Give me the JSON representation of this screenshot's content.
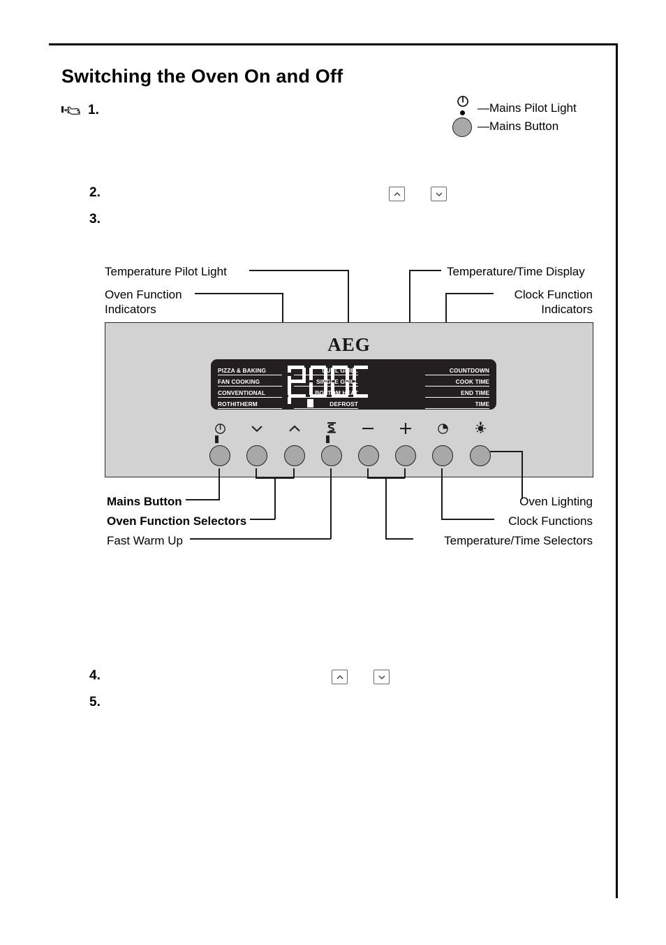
{
  "document": {
    "heading": "Switching the Oven On and Off",
    "steps": [
      {
        "n": "1."
      },
      {
        "n": "2."
      },
      {
        "n": "3."
      },
      {
        "n": "4."
      },
      {
        "n": "5."
      }
    ]
  },
  "legend": {
    "pilot_light_label": "Mains Pilot Light",
    "mains_button_label": "Mains Button"
  },
  "callouts": {
    "temperature_pilot_light": "Temperature Pilot Light",
    "oven_function_indicators_line1": "Oven Function",
    "oven_function_indicators_line2": "Indicators",
    "temperature_time_display": "Temperature/Time Display",
    "clock_function_indicators_line1": "Clock Function",
    "clock_function_indicators_line2": "Indicators",
    "mains_button": "Mains Button",
    "oven_function_selectors": "Oven Function Selectors",
    "fast_warm_up": "Fast Warm Up",
    "oven_lighting": "Oven Lighting",
    "clock_functions": "Clock Functions",
    "temperature_time_selectors": "Temperature/Time Selectors"
  },
  "panel": {
    "brand": "AEG",
    "display_value": "200C",
    "oven_functions_left": [
      "PIZZA & BAKING",
      "FAN COOKING",
      "CONVENTIONAL",
      "ROTHITHERM"
    ],
    "oven_functions_right": [
      "DUAL GRILL",
      "SINGLE GRILL",
      "BOTTOM HEAT",
      "DEFROST"
    ],
    "clock_functions": [
      "COUNTDOWN",
      "COOK TIME",
      "END TIME",
      "TIME"
    ],
    "buttons": [
      {
        "name": "mains",
        "icon": "power-icon"
      },
      {
        "name": "function-down",
        "icon": "chevron-down-icon"
      },
      {
        "name": "function-up",
        "icon": "chevron-up-icon"
      },
      {
        "name": "fast-warm-up",
        "icon": "fast-warm-up-icon"
      },
      {
        "name": "minus",
        "icon": "minus-icon"
      },
      {
        "name": "plus",
        "icon": "plus-icon"
      },
      {
        "name": "clock",
        "icon": "clock-icon"
      },
      {
        "name": "oven-light",
        "icon": "lamp-icon"
      }
    ],
    "colors": {
      "panel_face": "#d2d2d2",
      "display_background": "#231f20",
      "button_face": "#a8a8a8",
      "outline": "#1f1f1f"
    }
  },
  "keycaps": {
    "up": "chevron-up-icon",
    "down": "chevron-down-icon"
  }
}
